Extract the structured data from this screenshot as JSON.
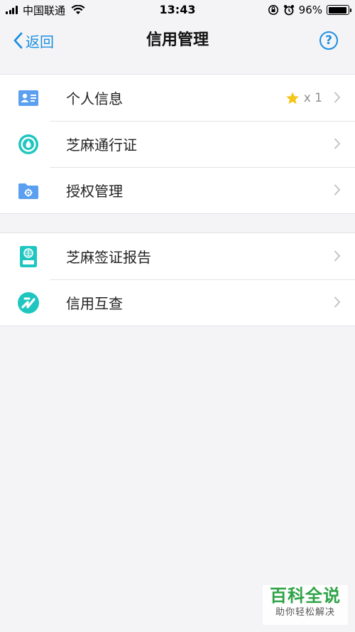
{
  "status_bar": {
    "carrier": "中国联通",
    "time": "13:43",
    "battery_percent_text": "96%",
    "battery_level": 0.96
  },
  "nav": {
    "back_label": "返回",
    "title": "信用管理",
    "help_glyph": "?"
  },
  "groups": [
    {
      "items": [
        {
          "label": "个人信息",
          "icon": "id-card-icon",
          "badge": "x 1",
          "badge_icon": "star-icon"
        },
        {
          "label": "芝麻通行证",
          "icon": "sesame-pass-icon"
        },
        {
          "label": "授权管理",
          "icon": "folder-gear-icon"
        }
      ]
    },
    {
      "items": [
        {
          "label": "芝麻签证报告",
          "icon": "visa-report-icon"
        },
        {
          "label": "信用互查",
          "icon": "credit-check-icon"
        }
      ]
    }
  ],
  "watermark": {
    "title": "百科全说",
    "subtitle": "助你轻松解决"
  },
  "colors": {
    "accent": "#1a8fe0",
    "background": "#f4f4f6",
    "icon_blue": "#5b9ff0",
    "icon_teal": "#1fc6c0",
    "star": "#f5c518"
  }
}
